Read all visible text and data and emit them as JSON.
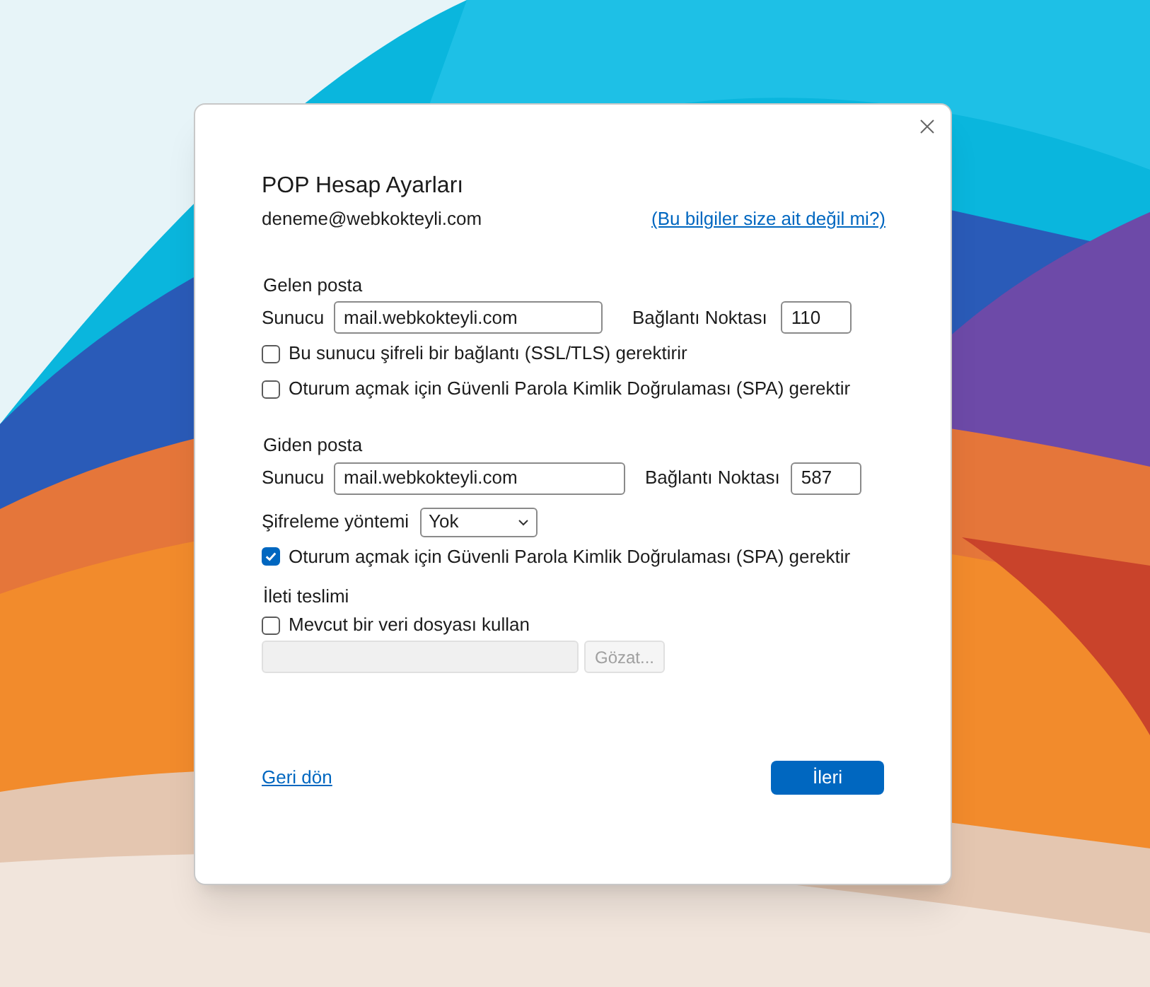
{
  "dialog": {
    "title": "POP Hesap Ayarları",
    "email": "deneme@webkokteyli.com",
    "not_you_link": "(Bu bilgiler size ait değil mi?)"
  },
  "incoming": {
    "heading": "Gelen posta",
    "server_label": "Sunucu",
    "server": "mail.webkokteyli.com",
    "port_label": "Bağlantı Noktası",
    "port": "110",
    "options": [
      {
        "label": "Bu sunucu şifreli bir bağlantı (SSL/TLS) gerektirir",
        "checked": false
      },
      {
        "label": "Oturum açmak için Güvenli Parola Kimlik Doğrulaması (SPA) gerektir",
        "checked": false
      }
    ]
  },
  "outgoing": {
    "heading": "Giden posta",
    "server_label": "Sunucu",
    "server": "mail.webkokteyli.com",
    "port_label": "Bağlantı Noktası",
    "port": "587",
    "encryption_label": "Şifreleme yöntemi",
    "encryption": "Yok",
    "options": [
      {
        "label": "Oturum açmak için Güvenli Parola Kimlik Doğrulaması (SPA) gerektir",
        "checked": true
      }
    ]
  },
  "delivery": {
    "heading": "İleti teslimi",
    "option": {
      "label": "Mevcut bir veri dosyası kullan",
      "checked": false
    },
    "browse_button": "Gözat...",
    "disabled": true
  },
  "footer": {
    "back_link": "Geri dön",
    "next_button": "İleri"
  }
}
